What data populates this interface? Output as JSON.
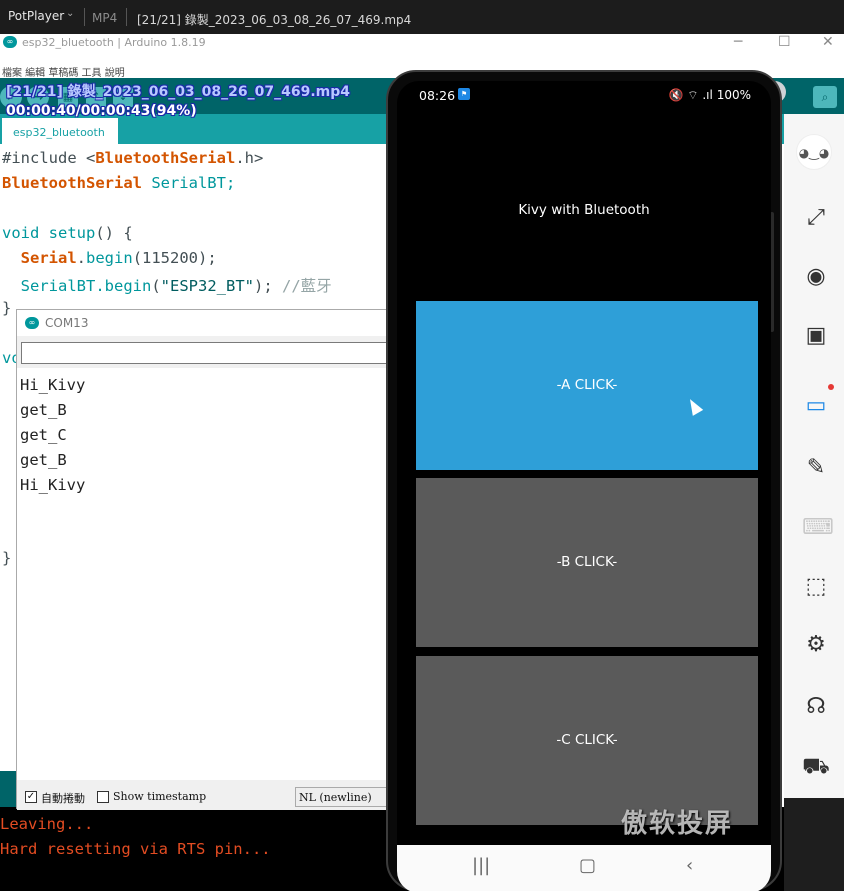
{
  "potplayer": {
    "app_name": "PotPlayer",
    "format": "MP4",
    "title": "[21/21] 錄製_2023_06_03_08_26_07_469.mp4"
  },
  "overlay": {
    "filename": "[21/21] 錄製_2023_06_03_08_26_07_469.mp4",
    "time": "00:00:40/00:00:43(94%)"
  },
  "arduino": {
    "window_title": "esp32_bluetooth | Arduino 1.8.19",
    "logo": "∞",
    "menu": "檔案  編輯  草稿碼  工具  說明",
    "tab": "esp32_bluetooth",
    "code": {
      "l1_a": "#include <",
      "l1_b": "BluetoothSerial",
      "l1_c": ".h>",
      "l2_a": "BluetoothSerial",
      "l2_b": " SerialBT;",
      "l4_a": "void",
      "l4_b": " ",
      "l4_c": "setup",
      "l4_d": "() {",
      "l5_a": "  ",
      "l5_b": "Serial",
      "l5_c": ".",
      "l5_d": "begin",
      "l5_e": "(115200);",
      "l6_a": "  SerialBT.",
      "l6_b": "begin",
      "l6_c": "(",
      "l6_d": "\"ESP32_BT\"",
      "l6_e": "); ",
      "l6_f": "//藍牙",
      "l7": "}",
      "l9": "vo",
      "l17": "}"
    },
    "console": [
      "Leaving...",
      "Hard resetting via RTS pin..."
    ]
  },
  "serial_monitor": {
    "title": "COM13",
    "output": [
      "Hi_Kivy",
      "get_B",
      "get_C",
      "get_B",
      "Hi_Kivy"
    ],
    "autoscroll_label": "自動捲動",
    "autoscroll_checked": true,
    "timestamp_label": "Show timestamp",
    "timestamp_checked": false,
    "line_ending": "NL (newline)"
  },
  "phone": {
    "time": "08:26",
    "battery": "100%",
    "status_icons": "🔇 ⌔ .ıl",
    "app_title": "Kivy with Bluetooth",
    "buttons": [
      "-A CLICK-",
      "-B CLICK-",
      "-C CLICK-"
    ],
    "button_colors": [
      "#2e9fd8",
      "#5a5a5a",
      "#5a5a5a"
    ],
    "nav": [
      "recents-icon",
      "home-icon",
      "back-icon"
    ],
    "watermark": "傲软投屏"
  },
  "right_toolbar": {
    "icons": [
      "mascot-icon",
      "fullscreen-icon",
      "screenshot-icon",
      "record-icon",
      "whiteboard-icon",
      "paint-icon",
      "keyboard-icon",
      "crop-icon",
      "settings-icon",
      "support-icon",
      "cart-icon"
    ]
  }
}
